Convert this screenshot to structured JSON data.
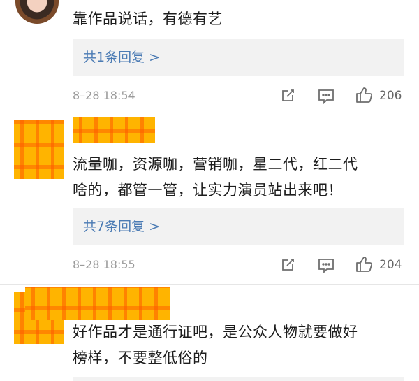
{
  "comments": [
    {
      "text": "靠作品说话，有德有艺",
      "replies_label": "共1条回复 >",
      "timestamp": "8–28 18:54",
      "likes": "206"
    },
    {
      "text_line1": "流量咖，资源咖，营销咖，星二代，红二代",
      "text_line2": "啥的，都管一管，让实力演员站出来吧！",
      "replies_label": "共7条回复 >",
      "timestamp": "8–28 18:55",
      "likes": "204"
    },
    {
      "text_line1": "好作品才是通行证吧，是公众人物就要做好",
      "text_line2": "榜样，不要整低俗的"
    }
  ],
  "icons": [
    "share-icon",
    "comment-icon",
    "like-icon"
  ],
  "colors": {
    "reply_link": "#4b7bb4",
    "reply_bg": "#f2f2f2",
    "mosaic": "#ffb400"
  }
}
